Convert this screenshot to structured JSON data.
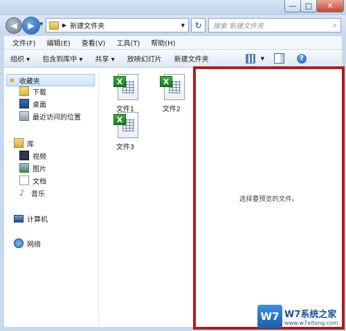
{
  "window": {
    "address_path": "新建文件夹",
    "search_placeholder": "搜索 新建文件夹"
  },
  "caption_buttons": {
    "minimize": "—",
    "maximize": "□",
    "close": "✕"
  },
  "menu": [
    {
      "label": "文件(F)"
    },
    {
      "label": "编辑(E)"
    },
    {
      "label": "查看(V)"
    },
    {
      "label": "工具(T)"
    },
    {
      "label": "帮助(H)"
    }
  ],
  "toolbar": {
    "organize": "组织 ▾",
    "include_library": "包含到库中 ▾",
    "share": "共享 ▾",
    "slideshow": "放映幻灯片",
    "new_folder": "新建文件夹"
  },
  "nav": {
    "favorites": "收藏夹",
    "downloads": "下载",
    "desktop": "桌面",
    "recent": "最近访问的位置",
    "libraries": "库",
    "videos": "视频",
    "pictures": "图片",
    "documents": "文档",
    "music": "音乐",
    "computer": "计算机",
    "network": "网络"
  },
  "files": [
    {
      "name": "文件1"
    },
    {
      "name": "文件2"
    },
    {
      "name": "文件3"
    }
  ],
  "preview": {
    "message": "选择要预览的文件。"
  },
  "watermark": {
    "logo": "W7",
    "site": "W7系统之家",
    "url": "www.w7xitong.com"
  },
  "colors": {
    "preview_border": "#b51a16",
    "excel_green": "#2a8f2a",
    "frame": "#c6d9ef"
  },
  "icons": [
    "back-arrow-icon",
    "forward-arrow-icon",
    "folder-icon",
    "refresh-icon",
    "search-icon",
    "star-icon",
    "excel-icon",
    "help-icon"
  ]
}
